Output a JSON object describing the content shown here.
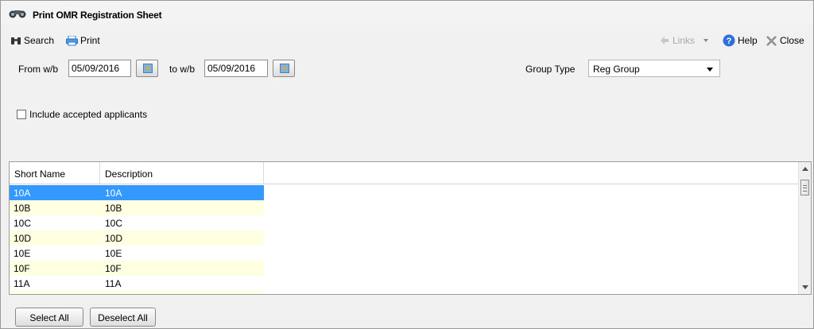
{
  "window": {
    "title": "Print OMR Registration Sheet",
    "title_icon": "binoculars-icon"
  },
  "toolbar": {
    "search_label": "Search",
    "search_icon": "binoculars-icon",
    "print_label": "Print",
    "print_icon": "printer-icon",
    "links_label": "Links",
    "help_label": "Help",
    "close_label": "Close"
  },
  "filters": {
    "from_label": "From w/b",
    "from_value": "05/09/2016",
    "to_label": "to w/b",
    "to_value": "05/09/2016",
    "group_type_label": "Group Type",
    "group_type_value": "Reg Group",
    "include_accepted_label": "Include accepted applicants",
    "include_accepted_checked": false
  },
  "list": {
    "columns": [
      "Short Name",
      "Description"
    ],
    "rows": [
      {
        "short_name": "10A",
        "description": "10A",
        "selected": true
      },
      {
        "short_name": "10B",
        "description": "10B"
      },
      {
        "short_name": "10C",
        "description": "10C"
      },
      {
        "short_name": "10D",
        "description": "10D"
      },
      {
        "short_name": "10E",
        "description": "10E"
      },
      {
        "short_name": "10F",
        "description": "10F"
      },
      {
        "short_name": "11A",
        "description": "11A"
      }
    ]
  },
  "footer": {
    "select_all_label": "Select All",
    "deselect_all_label": "Deselect All"
  },
  "colors": {
    "selected_row": "#3399ff",
    "alt_row": "#ffffe1",
    "help_icon": "#2f6fd6"
  }
}
